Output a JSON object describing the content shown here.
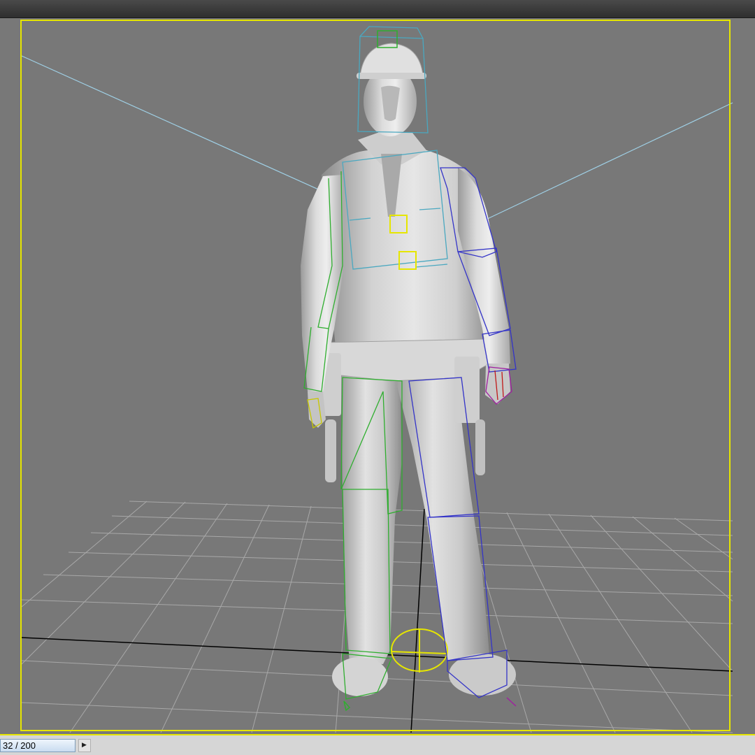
{
  "timeslider": {
    "frame_label": "32 / 200",
    "current_frame": 32,
    "total_frames": 200,
    "next_icon": "triangle-right"
  },
  "viewport": {
    "active_border_color": "#e6e600",
    "background_color": "#787878",
    "grid_color": "#a8a8a8"
  },
  "rig_colors": {
    "left_side": "#2fae2f",
    "right_side": "#3434c8",
    "center": "#4aa8c0",
    "root": "#e6e600",
    "hand": "#a020a0"
  }
}
